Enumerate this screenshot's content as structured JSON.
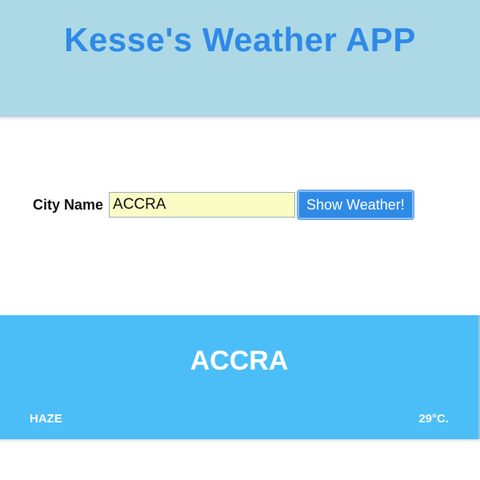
{
  "header": {
    "title": "Kesse's Weather APP"
  },
  "search": {
    "label": "City Name",
    "value": "ACCRA",
    "button_label": "Show Weather!"
  },
  "weather_card": {
    "city": "ACCRA",
    "condition": "HAZE",
    "temperature": "29°C."
  },
  "colors": {
    "header_bg": "#add8e6",
    "title": "#2f8ae6",
    "input_bg": "#fbfbc4",
    "button_bg": "#2f8ae6",
    "card_bg": "#4bbef8"
  }
}
